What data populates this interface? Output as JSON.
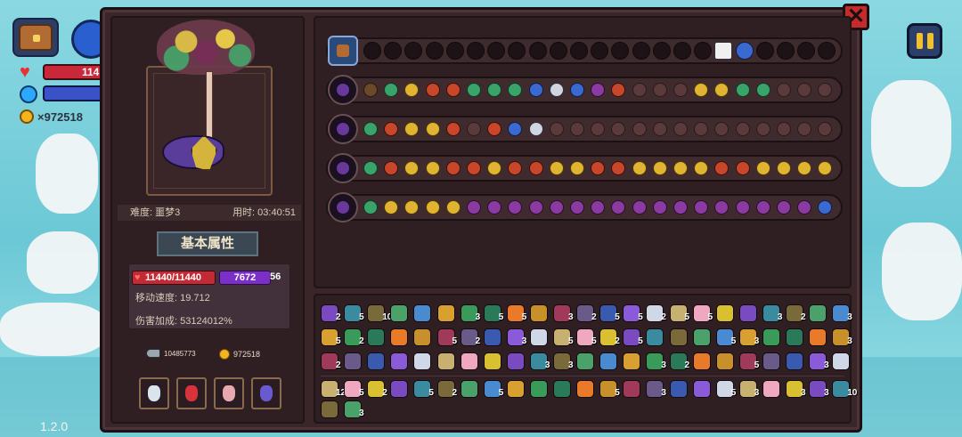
{
  "hud": {
    "hp_text": "114",
    "gold_text": "×972518",
    "version": "1.2.0"
  },
  "icons": {
    "chest": "chest-icon",
    "skill": "skill-orb-icon",
    "heart": "heart-icon",
    "mana": "mana-orb-icon",
    "coin": "coin-icon",
    "pause": "pause-icon",
    "close": "close-icon",
    "key": "key-icon"
  },
  "colors": {
    "panel": "#3a2629",
    "hp": "#c32a33",
    "mp": "#7b2fc6",
    "accent_gold": "#f2b520"
  },
  "panel": {
    "close_label": "✕",
    "difficulty": "难度: 噩梦3",
    "time_used": "用时: 03:40:51",
    "section_title": "基本属性",
    "hp": "11440/11440",
    "mp": "7672",
    "mp_suffix": "56",
    "move_speed": "移动速度: 19.712",
    "damage_bonus": "伤害加成: 53124012%",
    "keys": "10485773",
    "gold": "972518"
  },
  "inventory_counts": [
    "2",
    "5",
    "10",
    "",
    "",
    "",
    "3",
    "5",
    "5",
    "",
    "3",
    "2",
    "5",
    "5",
    "2",
    "5",
    "5",
    "",
    "",
    "3",
    "2",
    "",
    "3",
    "5",
    "2",
    "",
    "",
    "",
    "5",
    "2",
    "",
    "3",
    "",
    "5",
    "5",
    "2",
    "5",
    "",
    "",
    "",
    "5",
    "3",
    "",
    "",
    "",
    "3",
    "2",
    "",
    "",
    "",
    "",
    "",
    "",
    "",
    "",
    "3",
    "3",
    "",
    "",
    "",
    "3",
    "2",
    "",
    "",
    "5",
    "",
    "",
    "3",
    "",
    "122",
    "5",
    "2",
    "",
    "5",
    "2",
    "",
    "5",
    "",
    "",
    "",
    "",
    "5",
    "",
    "3",
    "",
    "",
    "5",
    "3",
    "",
    "3",
    "3",
    "10",
    "",
    "3"
  ]
}
